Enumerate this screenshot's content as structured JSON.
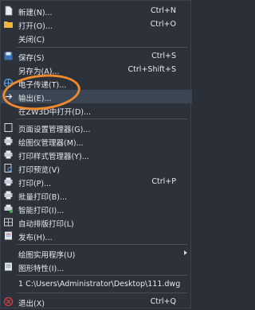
{
  "menu": {
    "items": [
      {
        "label": "新建(N)...",
        "shortcut": "Ctrl+N",
        "icon": "new-file-icon"
      },
      {
        "label": "打开(O)...",
        "shortcut": "Ctrl+O",
        "icon": "open-folder-icon"
      },
      {
        "label": "关闭(C)",
        "shortcut": "",
        "icon": "close-icon"
      },
      {
        "label": "保存(S)",
        "shortcut": "Ctrl+S",
        "icon": "save-icon"
      },
      {
        "label": "另存为(A)...",
        "shortcut": "Ctrl+Shift+S",
        "icon": "save-as-icon"
      },
      {
        "label": "电子传递(T)...",
        "shortcut": "",
        "icon": "etransmit-icon"
      },
      {
        "label": "输出(E)...",
        "shortcut": "",
        "icon": "export-icon"
      },
      {
        "label": "在ZW3D中打开(D)...",
        "shortcut": "",
        "icon": ""
      },
      {
        "label": "页面设置管理器(G)...",
        "shortcut": "",
        "icon": "page-setup-icon"
      },
      {
        "label": "绘图仪管理器(M)...",
        "shortcut": "",
        "icon": "plotter-icon"
      },
      {
        "label": "打印样式管理器(Y)...",
        "shortcut": "",
        "icon": "plot-style-icon"
      },
      {
        "label": "打印预览(V)",
        "shortcut": "",
        "icon": "print-preview-icon"
      },
      {
        "label": "打印(P)...",
        "shortcut": "Ctrl+P",
        "icon": "print-icon"
      },
      {
        "label": "批量打印(B)...",
        "shortcut": "",
        "icon": "batch-print-icon"
      },
      {
        "label": "智能打印(I)...",
        "shortcut": "",
        "icon": "smart-print-icon"
      },
      {
        "label": "自动排版打印(L)",
        "shortcut": "",
        "icon": "auto-layout-print-icon"
      },
      {
        "label": "发布(H)...",
        "shortcut": "",
        "icon": "publish-icon"
      },
      {
        "label": "绘图实用程序(U)",
        "shortcut": "",
        "icon": ""
      },
      {
        "label": "图形特性(I)...",
        "shortcut": "",
        "icon": "drawing-properties-icon"
      },
      {
        "label": "1 C:\\Users\\Administrator\\Desktop\\111.dwg",
        "shortcut": "",
        "icon": ""
      },
      {
        "label": "退出(X)",
        "shortcut": "Ctrl+Q",
        "icon": "exit-icon"
      }
    ]
  }
}
